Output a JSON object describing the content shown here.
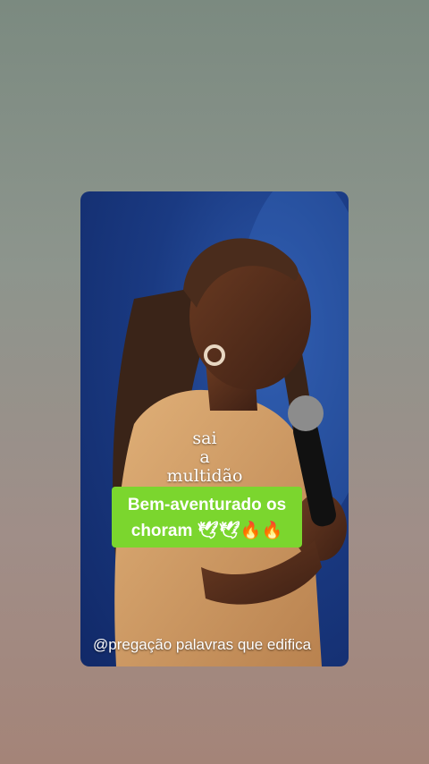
{
  "story": {
    "caption_lines": [
      "sai",
      "a",
      "multidão"
    ],
    "highlight_lines": [
      "Bem-aventurado os",
      "choram 🕊🕊🔥🔥"
    ],
    "watermark": "@pregação palavras que edifica"
  },
  "colors": {
    "highlight": "#7bd62e",
    "stage_blue": "#1a3a82"
  }
}
